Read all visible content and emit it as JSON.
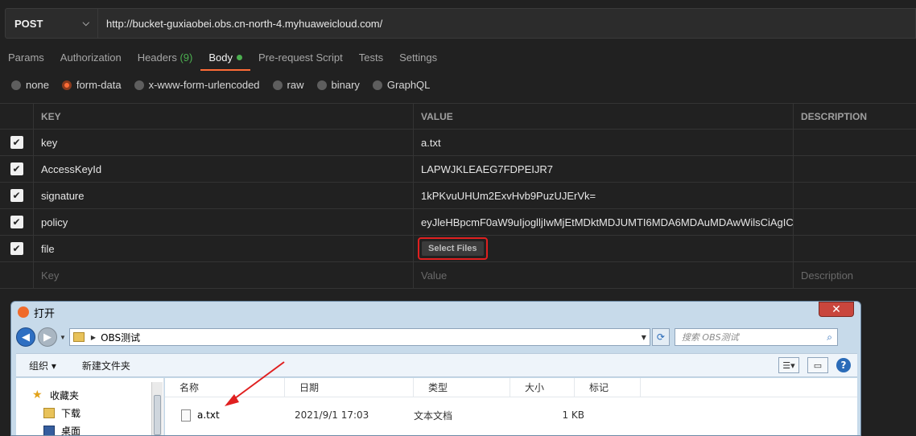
{
  "request": {
    "method": "POST",
    "url": "http://bucket-guxiaobei.obs.cn-north-4.myhuaweicloud.com/"
  },
  "tabs": [
    {
      "label": "Params"
    },
    {
      "label": "Authorization"
    },
    {
      "label": "Headers",
      "count": "(9)"
    },
    {
      "label": "Body"
    },
    {
      "label": "Pre-request Script"
    },
    {
      "label": "Tests"
    },
    {
      "label": "Settings"
    }
  ],
  "body_types": [
    {
      "label": "none"
    },
    {
      "label": "form-data",
      "selected": true
    },
    {
      "label": "x-www-form-urlencoded"
    },
    {
      "label": "raw"
    },
    {
      "label": "binary"
    },
    {
      "label": "GraphQL"
    }
  ],
  "table": {
    "headers": {
      "key": "KEY",
      "value": "VALUE",
      "description": "DESCRIPTION"
    },
    "rows": [
      {
        "key": "key",
        "value": "a.txt"
      },
      {
        "key": "AccessKeyId",
        "value": "LAPWJKLEAEG7FDPEIJR7"
      },
      {
        "key": "signature",
        "value": "1kPKvuUHUm2ExvHvb9PuzUJErVk="
      },
      {
        "key": "policy",
        "value": "eyJleHBpcmF0aW9uIjoglljIwMjEtMDktMDJUMTI6MDA6MDAuMDAwWilsCiAgIC..."
      },
      {
        "key": "file",
        "button": "Select Files"
      }
    ],
    "placeholders": {
      "key": "Key",
      "value": "Value",
      "description": "Description"
    }
  },
  "dialog": {
    "title": "打开",
    "close": "✕",
    "path_folder": "OBS测试",
    "search_placeholder": "搜索 OBS测试",
    "toolbar": {
      "organize": "组织 ▾",
      "new_folder": "新建文件夹"
    },
    "tree": [
      {
        "label": "收藏夹"
      },
      {
        "label": "下载"
      },
      {
        "label": "桌面"
      }
    ],
    "columns": {
      "name": "名称",
      "date": "日期",
      "type": "类型",
      "size": "大小",
      "tags": "标记"
    },
    "file": {
      "name": "a.txt",
      "date": "2021/9/1 17:03",
      "type": "文本文档",
      "size": "1 KB"
    }
  },
  "colors": {
    "accent": "#ff6c37",
    "success": "#4caf50",
    "highlight": "#e02020"
  }
}
